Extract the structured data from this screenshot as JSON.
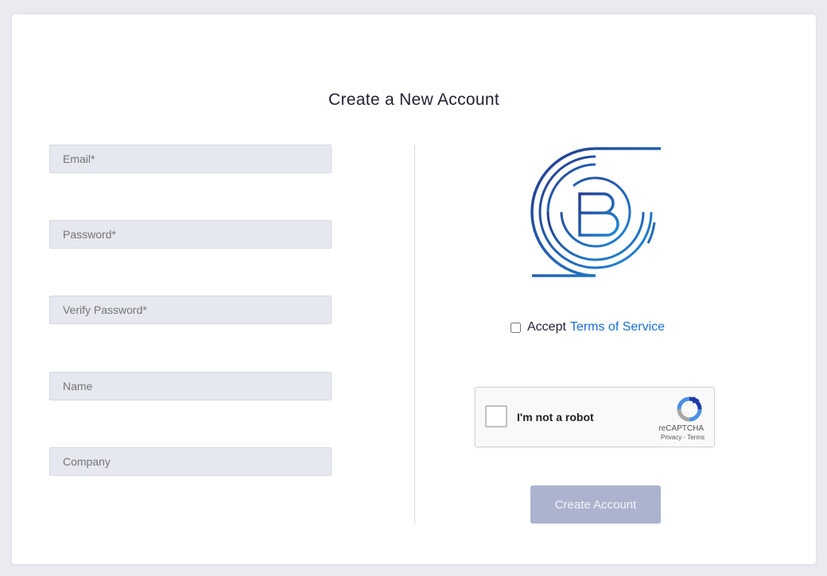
{
  "page": {
    "title": "Create a New Account"
  },
  "form": {
    "email_placeholder": "Email*",
    "password_placeholder": "Password*",
    "verify_password_placeholder": "Verify Password*",
    "name_placeholder": "Name",
    "company_placeholder": "Company"
  },
  "terms": {
    "accept_label": "Accept",
    "link_label": "Terms of Service",
    "checked": false
  },
  "recaptcha": {
    "label": "I'm not a robot",
    "brand": "reCAPTCHA",
    "privacy": "Privacy",
    "separator": " - ",
    "terms": "Terms"
  },
  "submit": {
    "label": "Create Account"
  },
  "colors": {
    "accent": "#1a6fd6",
    "button": "#acb3ce",
    "field_bg": "#e6e8ef",
    "logo_dark": "#243a8f",
    "logo_light": "#1f8ad6"
  },
  "icons": {
    "logo": "b-circuit-logo",
    "recaptcha": "recaptcha-icon"
  }
}
